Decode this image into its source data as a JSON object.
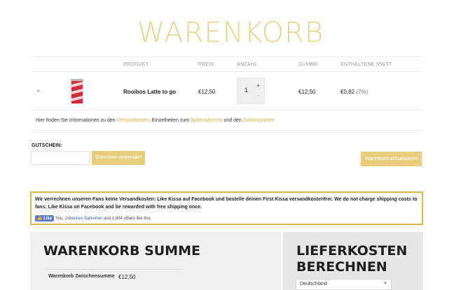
{
  "page": {
    "title": "WARENKORB"
  },
  "table": {
    "headers": {
      "product": "PRODUKT",
      "price": "PREIS",
      "qty": "ANZAHL",
      "sum": "SUMME",
      "tax": "ENTHALTENE MWST."
    },
    "row": {
      "remove": "×",
      "product_name": "Rooibos Latte to go",
      "price": "€12,50",
      "quantity": "1",
      "plus": "+",
      "minus": "-",
      "sum": "€12,50",
      "tax": "€0,82",
      "tax_rate": "(7%)"
    }
  },
  "info": {
    "prefix": "Hier finden Sie Informationen zu den ",
    "link1": "Versandkosten",
    "mid1": ", Einzelheiten zum ",
    "link2": "Widerrufsrecht",
    "mid2": " und den ",
    "link3": "Zahlungsarten"
  },
  "coupon": {
    "label": "GUTSCHEIN:",
    "value": "",
    "apply_label": "Gutschein anwenden",
    "update_label": "Warenkorb aktualisieren"
  },
  "notice": {
    "text": "Wir verrechnen unseren Fans keine Versandkosten: Like Kissa auf Facebook und bestelle deinen First Kissa versandkostenfrei. We do not charge shipping costs to fans: Like Kissa on Facebook and be rewarded with free shipping once.",
    "fb_like": "Like",
    "fb_you": "You, ",
    "fb_name": "Johannes Daheimer",
    "fb_rest": " and 1,604 others like this."
  },
  "totals": {
    "title": "WARENKORB SUMME",
    "subtotal_label": "Warenkorb Zwischensumme",
    "subtotal_value": "€12,50"
  },
  "shipping": {
    "title_line1": "LIEFERKOSTEN",
    "title_line2": "BERECHNEN",
    "country": "Deutschland"
  },
  "colors": {
    "accent": "#e8cd7a",
    "title": "#e8d48a",
    "border": "#dcb84a"
  }
}
